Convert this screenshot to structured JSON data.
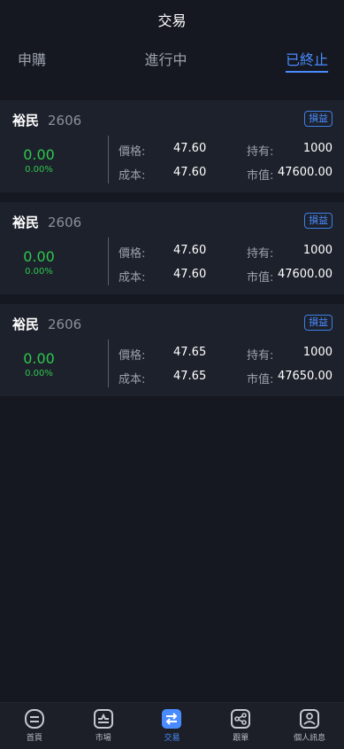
{
  "header": {
    "title": "交易"
  },
  "tabs": [
    {
      "label": "申購"
    },
    {
      "label": "進行中"
    },
    {
      "label": "已終止"
    }
  ],
  "labels": {
    "price": "價格:",
    "hold": "持有:",
    "cost": "成本:",
    "market": "市值:",
    "badge": "損益"
  },
  "cards": [
    {
      "name": "裕民",
      "code": "2606",
      "pl": "0.00",
      "pl_pct": "0.00%",
      "price": "47.60",
      "hold": "1000",
      "cost": "47.60",
      "market": "47600.00"
    },
    {
      "name": "裕民",
      "code": "2606",
      "pl": "0.00",
      "pl_pct": "0.00%",
      "price": "47.60",
      "hold": "1000",
      "cost": "47.60",
      "market": "47600.00"
    },
    {
      "name": "裕民",
      "code": "2606",
      "pl": "0.00",
      "pl_pct": "0.00%",
      "price": "47.65",
      "hold": "1000",
      "cost": "47.65",
      "market": "47650.00"
    }
  ],
  "tabbar": [
    {
      "label": "首頁",
      "icon": "home-icon"
    },
    {
      "label": "市場",
      "icon": "market-icon"
    },
    {
      "label": "交易",
      "icon": "trade-icon"
    },
    {
      "label": "跟單",
      "icon": "share-icon"
    },
    {
      "label": "個人訊息",
      "icon": "profile-icon"
    }
  ],
  "colors": {
    "accent": "#4a8cff",
    "gain": "#2ec84f",
    "background": "#151821",
    "card": "#1d212b"
  }
}
